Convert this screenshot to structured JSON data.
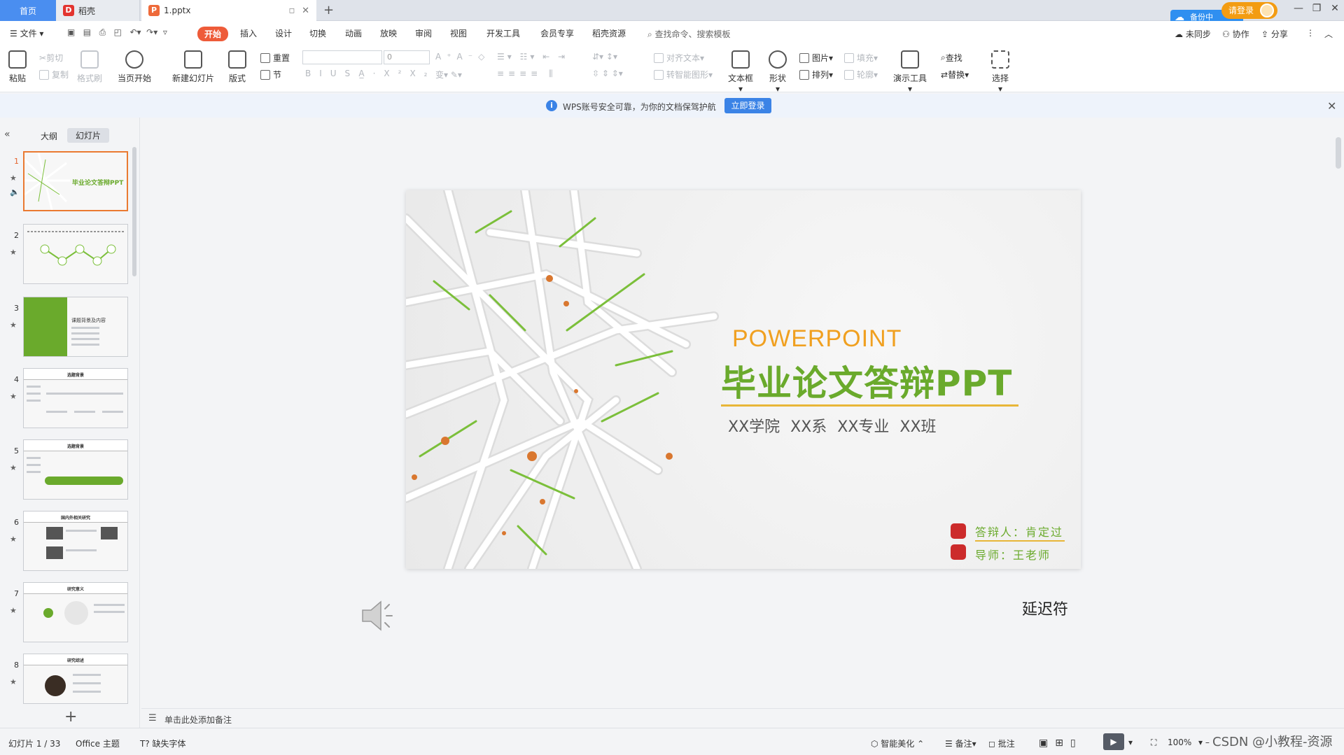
{
  "titlebar": {
    "tabs": [
      {
        "label": "首页"
      },
      {
        "label": "稻壳"
      },
      {
        "label": "1.pptx"
      }
    ],
    "new_tab": "+",
    "login": "请登录",
    "cloud_badge": "备份中"
  },
  "menu": {
    "file": "文件",
    "items": [
      "开始",
      "插入",
      "设计",
      "切换",
      "动画",
      "放映",
      "审阅",
      "视图",
      "开发工具",
      "会员专享",
      "稻壳资源"
    ],
    "search": "查找命令、搜索模板",
    "right": [
      "未同步",
      "协作",
      "分享"
    ]
  },
  "ribbon": {
    "paste": "粘贴",
    "cut": "剪切",
    "copy": "复制",
    "format_painter": "格式刷",
    "play_from": "当页开始",
    "new_slide": "新建幻灯片",
    "layout": "版式",
    "reset": "重置",
    "section": "节",
    "font_size": "0",
    "align_text": "对齐文本",
    "smartart": "转智能图形",
    "textbox": "文本框",
    "shape": "形状",
    "picture": "图片",
    "fill": "填充",
    "arrange": "排列",
    "outline": "轮廓",
    "present_tools": "演示工具",
    "find": "查找",
    "replace": "替换",
    "select": "选择"
  },
  "notice": {
    "text": "WPS账号安全可靠，为你的文档保驾护航",
    "button": "立即登录"
  },
  "leftpanel": {
    "tab_outline": "大纲",
    "tab_slides": "幻灯片",
    "slides": [
      {
        "num": "1",
        "title": "毕业论文答辩PPT"
      },
      {
        "num": "2",
        "title": ""
      },
      {
        "num": "3",
        "title": "课题背景及内容"
      },
      {
        "num": "4",
        "title": "选题背景"
      },
      {
        "num": "5",
        "title": "选题背景"
      },
      {
        "num": "6",
        "title": "国内外相关研究"
      },
      {
        "num": "7",
        "title": "研究意义"
      },
      {
        "num": "8",
        "title": "研究综述"
      }
    ],
    "add": "+"
  },
  "slide": {
    "en_title": "POWERPOINT",
    "title": "毕业论文答辩PPT",
    "subtitle": "XX学院 XX系 XX专业 XX班",
    "respondent": "答辩人：肯定过",
    "advisor": "导师：王老师",
    "accent_green": "#6aaa2c",
    "accent_gold": "#e8b638"
  },
  "canvas": {
    "delay_text": "延迟符"
  },
  "notes": {
    "placeholder": "单击此处添加备注"
  },
  "status": {
    "slide_count": "幻灯片 1 / 33",
    "theme": "Office 主题",
    "missing_font": "缺失字体",
    "beautify": "智能美化",
    "notes": "备注",
    "comments": "批注",
    "zoom": "100%",
    "watermark": "CSDN @小教程-资源"
  }
}
